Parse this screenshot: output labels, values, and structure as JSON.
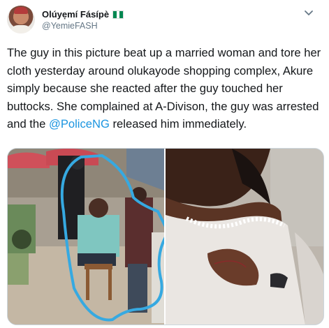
{
  "author": {
    "display_name": "Olúyẹmí Fásípè",
    "handle": "@YemieFASH",
    "flag_colors": [
      "#008751",
      "#ffffff",
      "#008751"
    ]
  },
  "icons": {
    "menu": "chevron-down-icon",
    "flag": "nigeria-flag-icon"
  },
  "tweet": {
    "text_segments": [
      "The guy in this picture beat up a married woman and tore her cloth yesterday around olukayode shopping complex, Akure simply because she reacted after the guy touched her buttocks. She complained at A-Divison, the guy was arrested and the ",
      "@PoliceNG",
      " released him immediately."
    ]
  },
  "colors": {
    "link": "#1b95e0",
    "secondary_text": "#657786",
    "border": "#ccd6dd",
    "circle_annotation": "#36a9e1"
  }
}
